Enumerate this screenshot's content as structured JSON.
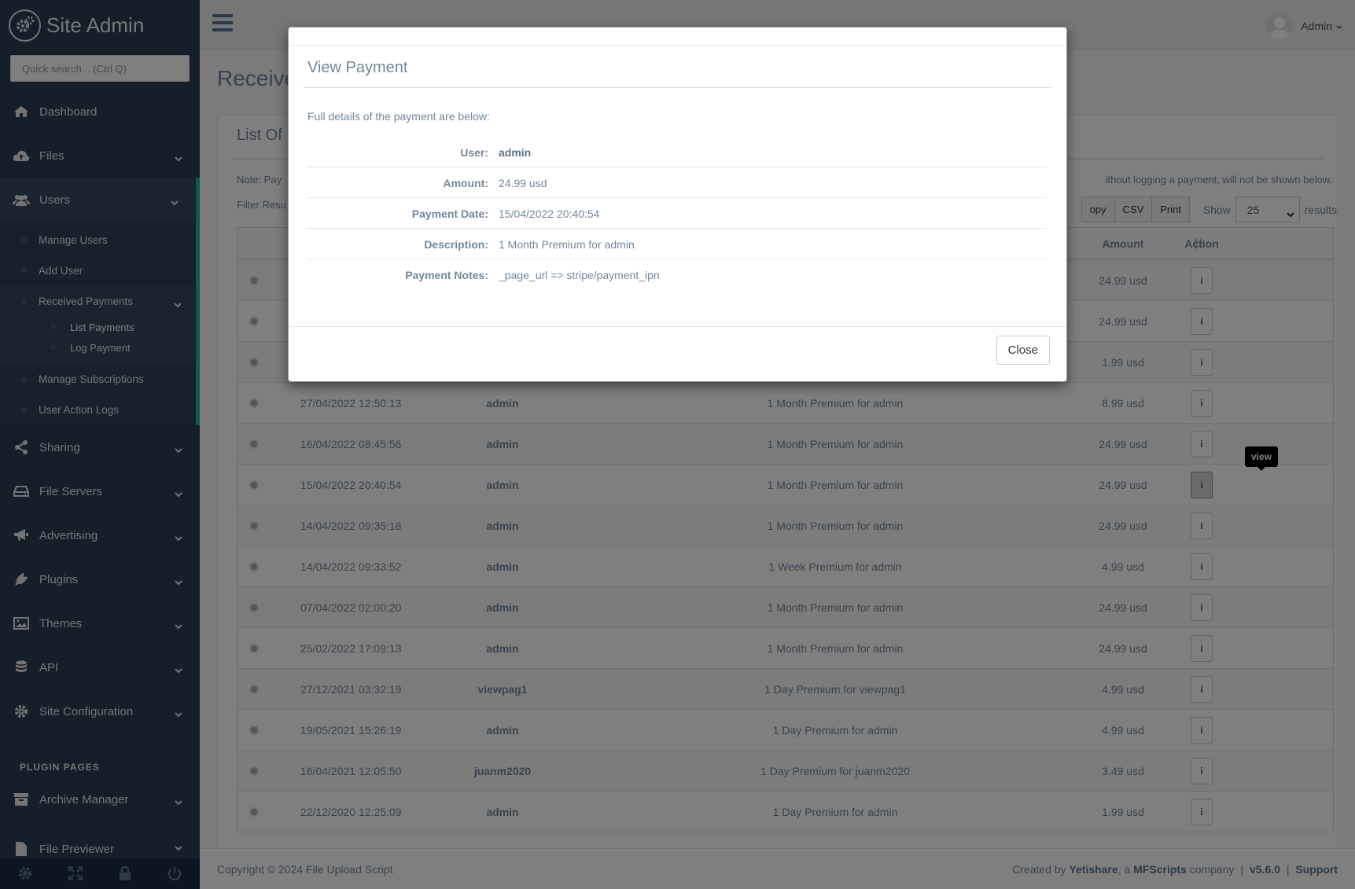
{
  "sidebar": {
    "brand": "Site Admin",
    "search_placeholder": "Quick search... (Ctrl Q)",
    "items": [
      {
        "label": "Dashboard"
      },
      {
        "label": "Files"
      },
      {
        "label": "Users"
      },
      {
        "label": "Sharing"
      },
      {
        "label": "File Servers"
      },
      {
        "label": "Advertising"
      },
      {
        "label": "Plugins"
      },
      {
        "label": "Themes"
      },
      {
        "label": "API"
      },
      {
        "label": "Site Configuration"
      }
    ],
    "users_sub": [
      "Manage Users",
      "Add User",
      "Received Payments",
      "Manage Subscriptions",
      "User Action Logs"
    ],
    "payments_sub": [
      "List Payments",
      "Log Payment"
    ],
    "plugin_pages_title": "PLUGIN PAGES",
    "plugin_items": [
      "Archive Manager",
      "File Previewer"
    ]
  },
  "topnav": {
    "user": "Admin"
  },
  "page": {
    "title": "Receive",
    "panel_title": "List Of",
    "note_left": "Note: Pay",
    "note_right": "ithout logging a payment, will not be shown below.",
    "filter_label": "Filter Resu",
    "buttons": [
      "opy",
      "CSV",
      "Print"
    ],
    "show_label": "Show",
    "show_value": "25",
    "results_label": "results"
  },
  "table": {
    "headers": {
      "amount": "Amount",
      "action": "Action"
    },
    "rows": [
      {
        "date": "",
        "user": "",
        "desc": "",
        "amount": "24.99 usd"
      },
      {
        "date": "",
        "user": "",
        "desc": "",
        "amount": "24.99 usd"
      },
      {
        "date": "",
        "user": "",
        "desc": "",
        "amount": "1.99 usd"
      },
      {
        "date": "27/04/2022 12:50:13",
        "user": "admin",
        "desc": "1 Month Premium for admin",
        "amount": "8.99 usd"
      },
      {
        "date": "16/04/2022 08:45:56",
        "user": "admin",
        "desc": "1 Month Premium for admin",
        "amount": "24.99 usd"
      },
      {
        "date": "15/04/2022 20:40:54",
        "user": "admin",
        "desc": "1 Month Premium for admin",
        "amount": "24.99 usd"
      },
      {
        "date": "14/04/2022 09:35:18",
        "user": "admin",
        "desc": "1 Month Premium for admin",
        "amount": "24.99 usd"
      },
      {
        "date": "14/04/2022 09:33:52",
        "user": "admin",
        "desc": "1 Week Premium for admin",
        "amount": "4.99 usd"
      },
      {
        "date": "07/04/2022 02:00:20",
        "user": "admin",
        "desc": "1 Month Premium for admin",
        "amount": "24.99 usd"
      },
      {
        "date": "25/02/2022 17:09:13",
        "user": "admin",
        "desc": "1 Month Premium for admin",
        "amount": "24.99 usd"
      },
      {
        "date": "27/12/2021 03:32:19",
        "user": "viewpag1",
        "desc": "1 Day Premium for viewpag1",
        "amount": "4.99 usd"
      },
      {
        "date": "19/05/2021 15:26:19",
        "user": "admin",
        "desc": "1 Day Premium for admin",
        "amount": "4.99 usd"
      },
      {
        "date": "16/04/2021 12:05:50",
        "user": "juanm2020",
        "desc": "1 Day Premium for juanm2020",
        "amount": "3.49 usd"
      },
      {
        "date": "22/12/2020 12:25:09",
        "user": "admin",
        "desc": "1 Day Premium for admin",
        "amount": "1.99 usd"
      }
    ],
    "action_glyph": "i",
    "tooltip": "view"
  },
  "footer": {
    "copyright": "Copyright © 2024 File Upload Script",
    "created_by": "Created by",
    "yetishare": "Yetishare",
    "a": ", a",
    "mfscripts": "MFScripts",
    "company": "company",
    "sep": "|",
    "version": "v5.6.0",
    "support": "Support"
  },
  "modal": {
    "title": "View Payment",
    "intro": "Full details of the payment are below:",
    "fields": [
      {
        "label": "User:",
        "value": "admin"
      },
      {
        "label": "Amount:",
        "value": "24.99 usd"
      },
      {
        "label": "Payment Date:",
        "value": "15/04/2022 20:40:54"
      },
      {
        "label": "Description:",
        "value": "1 Month Premium for admin"
      },
      {
        "label": "Payment Notes:",
        "value": "_page_url => stripe/payment_ipn"
      }
    ],
    "close_label": "Close"
  }
}
